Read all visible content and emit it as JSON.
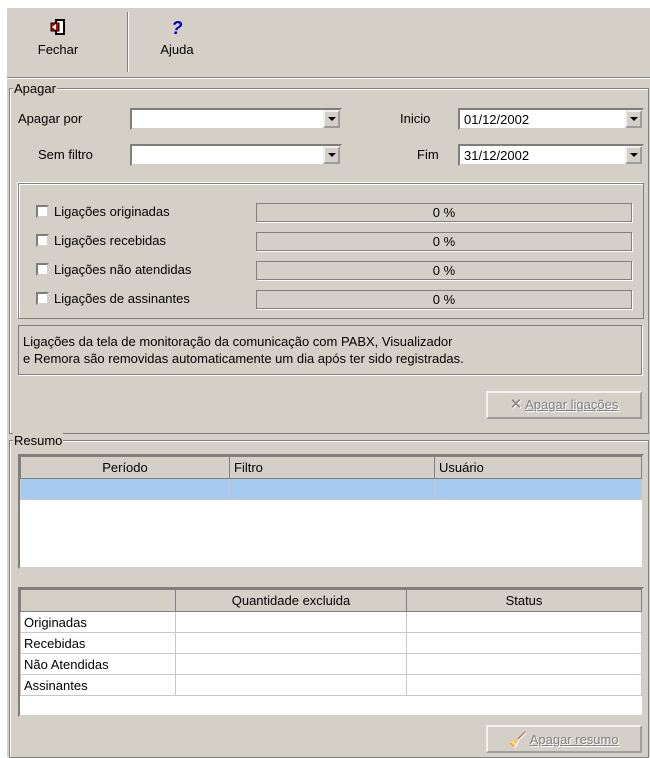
{
  "toolbar": {
    "close": {
      "label": "Fechar",
      "icon": "exit-door-icon"
    },
    "help": {
      "label": "Ajuda",
      "icon": "question-mark-icon"
    }
  },
  "apagar": {
    "title": "Apagar",
    "apagar_por_label": "Apagar por",
    "apagar_por_value": "",
    "sem_filtro_label": "Sem filtro",
    "sem_filtro_value": "",
    "inicio_label": "Inicio",
    "inicio_value": "01/12/2002",
    "fim_label": "Fim",
    "fim_value": "31/12/2002",
    "items": [
      {
        "label": "Ligações originadas",
        "checked": false,
        "progress": "0 %"
      },
      {
        "label": "Ligações recebidas",
        "checked": false,
        "progress": "0 %"
      },
      {
        "label": "Ligações não atendidas",
        "checked": false,
        "progress": "0 %"
      },
      {
        "label": "Ligações de assinantes",
        "checked": false,
        "progress": "0 %"
      }
    ],
    "note_line1": "Ligações da  tela de monitoração da comunicação com PABX, Visualizador",
    "note_line2": "e Remora são removidas automaticamente um dia após ter sido registradas.",
    "delete_button": "Apagar ligações"
  },
  "resumo": {
    "title": "Resumo",
    "columns": [
      "Período",
      "Filtro",
      "Usuário"
    ],
    "details_columns": [
      "",
      "Quantidade excluida",
      "Status"
    ],
    "details_rows": [
      "Originadas",
      "Recebidas",
      "Não Atendidas",
      "Assinantes"
    ],
    "delete_button": "Apagar resumo"
  },
  "colors": {
    "face": "#d4d0c8",
    "selection": "#a6caf0"
  }
}
